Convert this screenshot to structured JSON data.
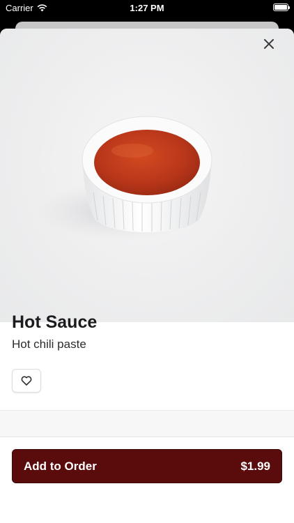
{
  "status_bar": {
    "carrier": "Carrier",
    "time": "1:27 PM"
  },
  "product": {
    "name": "Hot Sauce",
    "description": "Hot chili paste",
    "image_icon": "hot-sauce-ramekin-photo"
  },
  "actions": {
    "close_icon": "close-icon",
    "favorite_icon": "heart-icon",
    "add_label": "Add to Order",
    "price": "$1.99"
  },
  "colors": {
    "accent": "#5a0b0c",
    "sauce": "#c2401c",
    "background": "#ffffff"
  }
}
